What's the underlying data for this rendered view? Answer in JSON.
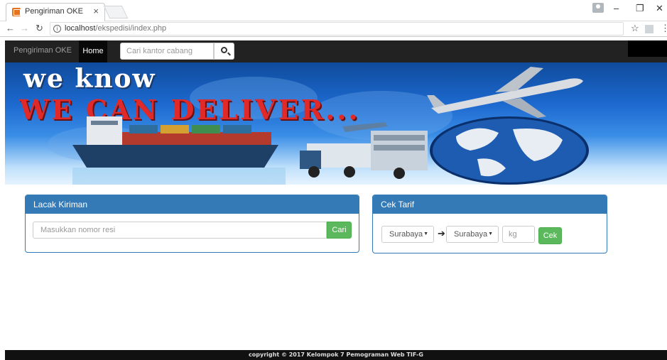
{
  "browser": {
    "tab_title": "Pengiriman OKE",
    "tab_close": "×",
    "url_host": "localhost",
    "url_path": "/ekspedisi/index.php"
  },
  "navbar": {
    "brand": "Pengiriman OKE",
    "home": "Home",
    "search_placeholder": "Cari kantor cabang"
  },
  "banner": {
    "line1": "we know",
    "line2": "WE CAN DELIVER..."
  },
  "lacak": {
    "title": "Lacak Kiriman",
    "input_placeholder": "Masukkan nomor resi",
    "button": "Cari"
  },
  "tarif": {
    "title": "Cek Tarif",
    "from": "Surabaya",
    "to": "Surabaya",
    "weight_placeholder": "kg",
    "button": "Cek"
  },
  "footer": {
    "text": "copyright © 2017 Kelompok 7 Pemograman Web TIF-G"
  },
  "colors": {
    "primary": "#337ab7",
    "success": "#5cb85c",
    "navbar": "#222222"
  }
}
